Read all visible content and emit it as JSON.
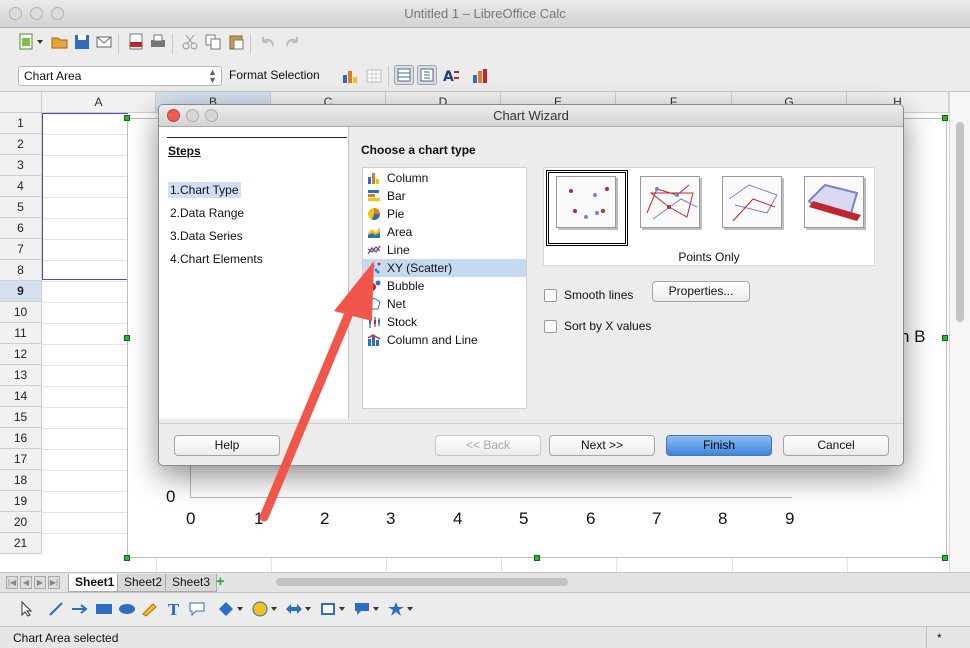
{
  "window": {
    "title": "Untitled 1 – LibreOffice Calc"
  },
  "toolbar": {
    "chart_element_combo": "Chart Area",
    "format_selection_label": "Format Selection"
  },
  "sheet": {
    "columns": [
      "A",
      "B",
      "C",
      "D",
      "E",
      "F",
      "G",
      "H"
    ],
    "rows": [
      "1",
      "2",
      "3",
      "4",
      "5",
      "6",
      "7",
      "8",
      "9",
      "10",
      "11",
      "12",
      "13",
      "14",
      "15",
      "16",
      "17",
      "18",
      "19",
      "20",
      "21"
    ],
    "selected_row": "9",
    "chart_x_ticks": [
      "0",
      "1",
      "2",
      "3",
      "4",
      "5",
      "6",
      "7",
      "8",
      "9"
    ],
    "chart_y_tick": "0",
    "chart_legend_partial": "n B"
  },
  "dialog": {
    "title": "Chart Wizard",
    "steps_title": "Steps",
    "steps": [
      {
        "num": "1.",
        "label": "Chart Type"
      },
      {
        "num": "2.",
        "label": "Data Range"
      },
      {
        "num": "3.",
        "label": "Data Series"
      },
      {
        "num": "4.",
        "label": "Chart Elements"
      }
    ],
    "current_step": 0,
    "choose_label": "Choose a chart type",
    "chart_types": [
      "Column",
      "Bar",
      "Pie",
      "Area",
      "Line",
      "XY (Scatter)",
      "Bubble",
      "Net",
      "Stock",
      "Column and Line"
    ],
    "selected_type": 5,
    "variant_label": "Points Only",
    "smooth_lines_label": "Smooth lines",
    "properties_label": "Properties...",
    "sort_label": "Sort by X values",
    "buttons": {
      "help": "Help",
      "back": "<< Back",
      "next": "Next >>",
      "finish": "Finish",
      "cancel": "Cancel"
    }
  },
  "sheet_tabs": [
    "Sheet1",
    "Sheet2",
    "Sheet3"
  ],
  "active_sheet": 0,
  "status": {
    "text": "Chart Area selected",
    "marker": "*"
  },
  "colors": {
    "accent": "#3d86db",
    "arrow": "#f0574a",
    "selection": "#c5d9f1"
  }
}
